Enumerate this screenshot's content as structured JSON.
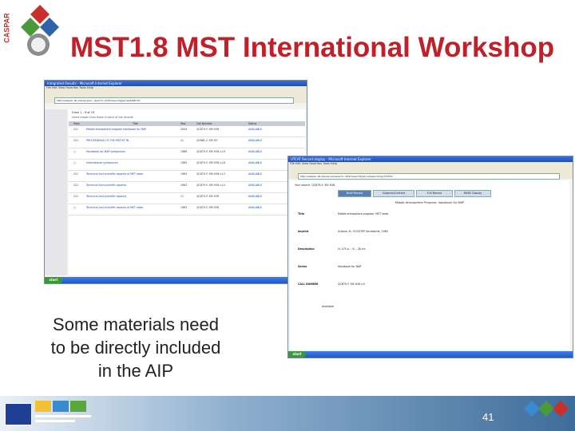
{
  "slide": {
    "title": "MST1.8 MST International Workshop",
    "caption_lines": [
      "Some materials need",
      "to be directly included",
      "in the AIP"
    ],
    "page_number": "41",
    "logo_text": "CASPAR"
  },
  "colors": {
    "title": "#c0202a",
    "footer_dark": "#3e6d9a",
    "logo_red": "#c9302c",
    "logo_green": "#4a9a3c",
    "logo_blue": "#2f63a8"
  },
  "left_window": {
    "title": "Integrated Results - Microsoft Internet Explorer",
    "menu": "File  Edit  View  Favorites  Tools  Help",
    "address": "http://webpac.lib.utexas.edu/.../search~S29/?searchtype=s&SORT=D",
    "heading": "Lines 1 - 9 of 19",
    "subheading": "Some chosen from those in some of the records.",
    "columns": [
      "Mark",
      "Year",
      "Call Number",
      "Title",
      "Status"
    ],
    "rows": [
      {
        "mark": "211",
        "title": "Middle atmosphere program handbook for MAP",
        "year": "2004",
        "call": "QC879.5 .M5 H36",
        "status": "AVAILABLE"
      },
      {
        "mark": "211",
        "title": "PROCEEDINGS OF THE MST/ST IN",
        "year": "11",
        "call": "QC881.2 .M5 I57",
        "status": "AVAILABLE"
      },
      {
        "mark": "□",
        "title": "Handbook for MAP symposium",
        "year": "1986",
        "call": "QC879.5 .M5 H36 v.19",
        "status": "AVAILABLE"
      },
      {
        "mark": "□",
        "title": "International symposium",
        "year": "1985",
        "call": "QC879.5 .M5 H36 v.18",
        "status": "AVAILABLE"
      },
      {
        "mark": "211",
        "title": "Technical and scientific aspects of MST radar",
        "year": "1983",
        "call": "QC879.5 .M5 H36 v.13",
        "status": "AVAILABLE"
      },
      {
        "mark": "211",
        "title": "Technical and scientific aspects",
        "year": "1983",
        "call": "QC879.5 .M5 H36 v.14",
        "status": "AVAILABLE"
      },
      {
        "mark": "211",
        "title": "Technical and scientific aspects",
        "year": "11",
        "call": "QC879.5 .M5 H36",
        "status": "AVAILABLE"
      },
      {
        "mark": "□",
        "title": "Technical and scientific aspects of MST radar",
        "year": "1983",
        "call": "QC879.5 .M5 H36",
        "status": "AVAILABLE"
      }
    ]
  },
  "right_window": {
    "title": "UTCAT Record display - Microsoft Internet Explorer",
    "menu": "File  Edit  View  Favorites  Tools  Help",
    "address": "http://webpac.lib.utexas.edu/search~S29/?searchtype=c&searcharg=QC879",
    "breadcrumb": "Your search: QC879.5 .M5 H36",
    "tabs": [
      "Brief Record",
      "Subjects/Content",
      "Full Record",
      "MARC Display"
    ],
    "record_title": "Middle Atmosphere Program: handbook for MAP",
    "fields": [
      {
        "label": "Title",
        "value": "Middle atmosphere program: MST radar"
      },
      {
        "label": "Imprint",
        "value": "Urbana, Ill.: SCOSTEP Secretariat, 1983"
      },
      {
        "label": "Description",
        "value": "iii, 475 p. : ill. ; 28 cm"
      },
      {
        "label": "Series",
        "value": "Handbook for MAP"
      },
      {
        "label": "CALL NUMBER",
        "value": "QC879.5 .M5 H36 v.9"
      }
    ],
    "status": "Available"
  }
}
